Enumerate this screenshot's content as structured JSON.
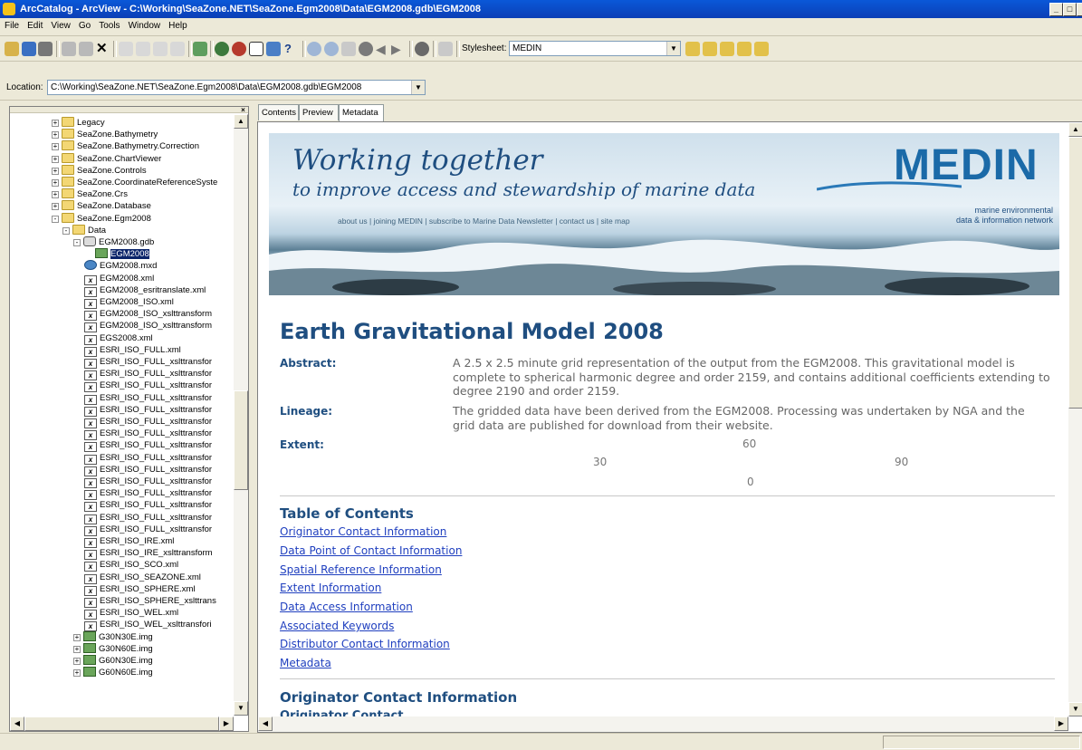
{
  "window": {
    "title": "ArcCatalog - ArcView - C:\\Working\\SeaZone.NET\\SeaZone.Egm2008\\Data\\EGM2008.gdb\\EGM2008"
  },
  "menu": [
    "File",
    "Edit",
    "View",
    "Go",
    "Tools",
    "Window",
    "Help"
  ],
  "toolbar": {
    "stylesheet_label": "Stylesheet:",
    "stylesheet_value": "MEDIN"
  },
  "location": {
    "label": "Location:",
    "value": "C:\\Working\\SeaZone.NET\\SeaZone.Egm2008\\Data\\EGM2008.gdb\\EGM2008"
  },
  "tree": [
    {
      "label": "Legacy",
      "icon": "folder",
      "expander": "+"
    },
    {
      "label": "SeaZone.Bathymetry",
      "icon": "folder",
      "expander": "+"
    },
    {
      "label": "SeaZone.Bathymetry.Correction",
      "icon": "folder",
      "expander": "+"
    },
    {
      "label": "SeaZone.ChartViewer",
      "icon": "folder",
      "expander": "+"
    },
    {
      "label": "SeaZone.Controls",
      "icon": "folder",
      "expander": "+"
    },
    {
      "label": "SeaZone.CoordinateReferenceSyste",
      "icon": "folder",
      "expander": "+"
    },
    {
      "label": "SeaZone.Crs",
      "icon": "folder",
      "expander": "+"
    },
    {
      "label": "SeaZone.Database",
      "icon": "folder",
      "expander": "+"
    },
    {
      "label": "SeaZone.Egm2008",
      "icon": "folder",
      "expander": "-"
    },
    {
      "label": "Data",
      "icon": "folder",
      "expander": "-"
    },
    {
      "label": "EGM2008.gdb",
      "icon": "gdb",
      "expander": "-"
    },
    {
      "label": "EGM2008",
      "icon": "raster",
      "selected": true
    },
    {
      "label": "EGM2008.mxd",
      "icon": "mxd"
    },
    {
      "label": "EGM2008.xml",
      "icon": "xml"
    },
    {
      "label": "EGM2008_esritranslate.xml",
      "icon": "xml"
    },
    {
      "label": "EGM2008_ISO.xml",
      "icon": "xml"
    },
    {
      "label": "EGM2008_ISO_xslttransform",
      "icon": "xml"
    },
    {
      "label": "EGM2008_ISO_xslttransform",
      "icon": "xml"
    },
    {
      "label": "EGS2008.xml",
      "icon": "xml"
    },
    {
      "label": "ESRI_ISO_FULL.xml",
      "icon": "xml"
    },
    {
      "label": "ESRI_ISO_FULL_xslttransfor",
      "icon": "xml"
    },
    {
      "label": "ESRI_ISO_FULL_xslttransfor",
      "icon": "xml"
    },
    {
      "label": "ESRI_ISO_FULL_xslttransfor",
      "icon": "xml"
    },
    {
      "label": "ESRI_ISO_FULL_xslttransfor",
      "icon": "xml"
    },
    {
      "label": "ESRI_ISO_FULL_xslttransfor",
      "icon": "xml"
    },
    {
      "label": "ESRI_ISO_FULL_xslttransfor",
      "icon": "xml"
    },
    {
      "label": "ESRI_ISO_FULL_xslttransfor",
      "icon": "xml"
    },
    {
      "label": "ESRI_ISO_FULL_xslttransfor",
      "icon": "xml"
    },
    {
      "label": "ESRI_ISO_FULL_xslttransfor",
      "icon": "xml"
    },
    {
      "label": "ESRI_ISO_FULL_xslttransfor",
      "icon": "xml"
    },
    {
      "label": "ESRI_ISO_FULL_xslttransfor",
      "icon": "xml"
    },
    {
      "label": "ESRI_ISO_FULL_xslttransfor",
      "icon": "xml"
    },
    {
      "label": "ESRI_ISO_FULL_xslttransfor",
      "icon": "xml"
    },
    {
      "label": "ESRI_ISO_FULL_xslttransfor",
      "icon": "xml"
    },
    {
      "label": "ESRI_ISO_FULL_xslttransfor",
      "icon": "xml"
    },
    {
      "label": "ESRI_ISO_IRE.xml",
      "icon": "xml"
    },
    {
      "label": "ESRI_ISO_IRE_xslttransform",
      "icon": "xml"
    },
    {
      "label": "ESRI_ISO_SCO.xml",
      "icon": "xml"
    },
    {
      "label": "ESRI_ISO_SEAZONE.xml",
      "icon": "xml"
    },
    {
      "label": "ESRI_ISO_SPHERE.xml",
      "icon": "xml"
    },
    {
      "label": "ESRI_ISO_SPHERE_xslttrans",
      "icon": "xml"
    },
    {
      "label": "ESRI_ISO_WEL.xml",
      "icon": "xml"
    },
    {
      "label": "ESRI_ISO_WEL_xslttransfori",
      "icon": "xml"
    },
    {
      "label": "G30N30E.img",
      "icon": "img",
      "expander": "+"
    },
    {
      "label": "G30N60E.img",
      "icon": "img",
      "expander": "+"
    },
    {
      "label": "G60N30E.img",
      "icon": "img",
      "expander": "+"
    },
    {
      "label": "G60N60E.img",
      "icon": "img",
      "expander": "+"
    }
  ],
  "tabs": [
    "Contents",
    "Preview",
    "Metadata"
  ],
  "banner": {
    "line1": "Working together",
    "line2": "to improve access and stewardship of marine data",
    "links": [
      "about us",
      "joining MEDIN",
      "subscribe to Marine Data Newsletter",
      "contact us",
      "site map"
    ],
    "logo": "MEDIN",
    "logo_sub1": "marine environmental",
    "logo_sub2": "data & information network"
  },
  "metadata": {
    "title": "Earth Gravitational Model 2008",
    "abstract_label": "Abstract:",
    "abstract": "A 2.5 x 2.5 minute grid representation of the output from the EGM2008. This gravitational model is complete to spherical harmonic degree and order 2159, and contains additional coefficients extending to degree 2190 and order 2159.",
    "lineage_label": "Lineage:",
    "lineage": "The gridded data have been derived from the EGM2008. Processing was undertaken by NGA and the grid data are published for download from their website.",
    "extent_label": "Extent:",
    "extent_north": "60",
    "extent_west": "30",
    "extent_east": "90",
    "extent_south": "0",
    "toc_title": "Table of Contents",
    "toc": [
      "Originator Contact Information",
      "Data Point of Contact Information",
      "Spatial Reference Information",
      "Extent Information",
      "Data Access Information",
      "Associated Keywords",
      "Distributor Contact Information",
      "Metadata"
    ],
    "section_title": "Originator Contact Information",
    "section_sub": "Originator Contact"
  },
  "colors": {
    "heading": "#1f4e80",
    "link": "#1f3fbf",
    "selection": "#0a246a",
    "titlebar": "#0b3fb6"
  }
}
